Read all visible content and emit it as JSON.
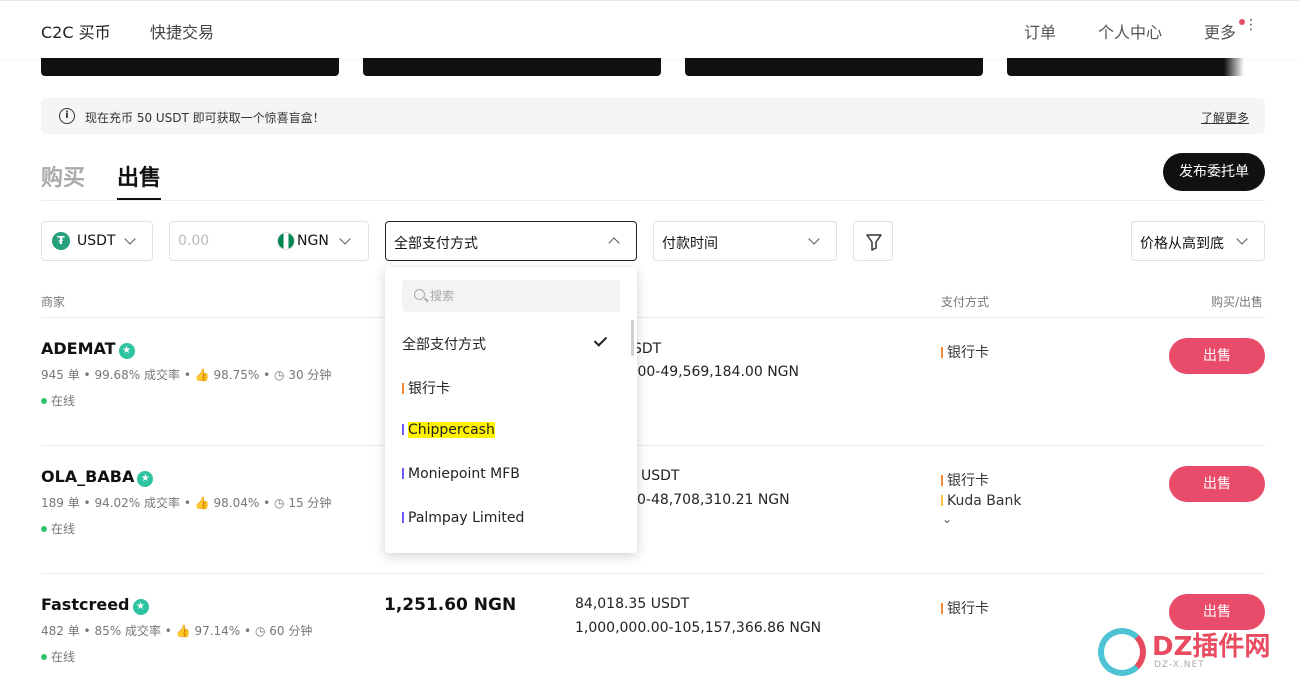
{
  "nav": {
    "left": [
      "C2C 买币",
      "快捷交易"
    ],
    "right": [
      "订单",
      "个人中心",
      "更多"
    ]
  },
  "notice": {
    "text": "现在充币 50 USDT 即可获取一个惊喜盲盒！",
    "link": "了解更多"
  },
  "tabs": {
    "buy": "购买",
    "sell": "出售"
  },
  "publish_button": "发布委托单",
  "filters": {
    "crypto": "USDT",
    "amount_placeholder": "0.00",
    "fiat": "NGN",
    "payment": "全部支付方式",
    "time": "付款时间",
    "sort": "价格从高到底"
  },
  "table_headers": {
    "merchant": "商家",
    "payment": "支付方式",
    "action": "购买/出售"
  },
  "dropdown": {
    "search_placeholder": "搜索",
    "items": [
      {
        "label": "全部支付方式",
        "selected": true
      },
      {
        "label": "银行卡",
        "color": "#f08a3a"
      },
      {
        "label": "Chippercash",
        "color": "#6a5cff"
      },
      {
        "label": "Moniepoint MFB",
        "color": "#6a5cff"
      },
      {
        "label": "Palmpay Limited",
        "color": "#6a5cff"
      }
    ]
  },
  "rows": [
    {
      "name": "ADEMAT",
      "orders": "945 单",
      "completion": "99.68% 成交率",
      "positive": "98.75%",
      "time": "30 分钟",
      "status": "在线",
      "available_partial": "SDT",
      "limit_partial": ".00-49,569,184.00 NGN",
      "payments": [
        "银行卡"
      ],
      "action": "出售"
    },
    {
      "name": "OLA_BABA",
      "orders": "189 单",
      "completion": "94.02% 成交率",
      "positive": "98.04%",
      "time": "15 分钟",
      "status": "在线",
      "available_partial": "USDT",
      "limit_partial": "0-48,708,310.21 NGN",
      "payments": [
        "银行卡",
        "Kuda Bank"
      ],
      "action": "出售"
    },
    {
      "name": "Fastcreed",
      "orders": "482 单",
      "completion": "85% 成交率",
      "positive": "97.14%",
      "time": "60 分钟",
      "status": "在线",
      "price": "1,251.60 NGN",
      "available": "84,018.35 USDT",
      "limit": "1,000,000.00-105,157,366.86 NGN",
      "payments": [
        "银行卡"
      ],
      "action": "出售"
    }
  ],
  "watermark": {
    "text": "DZ插件网",
    "sub": "DZ-X.NET"
  }
}
